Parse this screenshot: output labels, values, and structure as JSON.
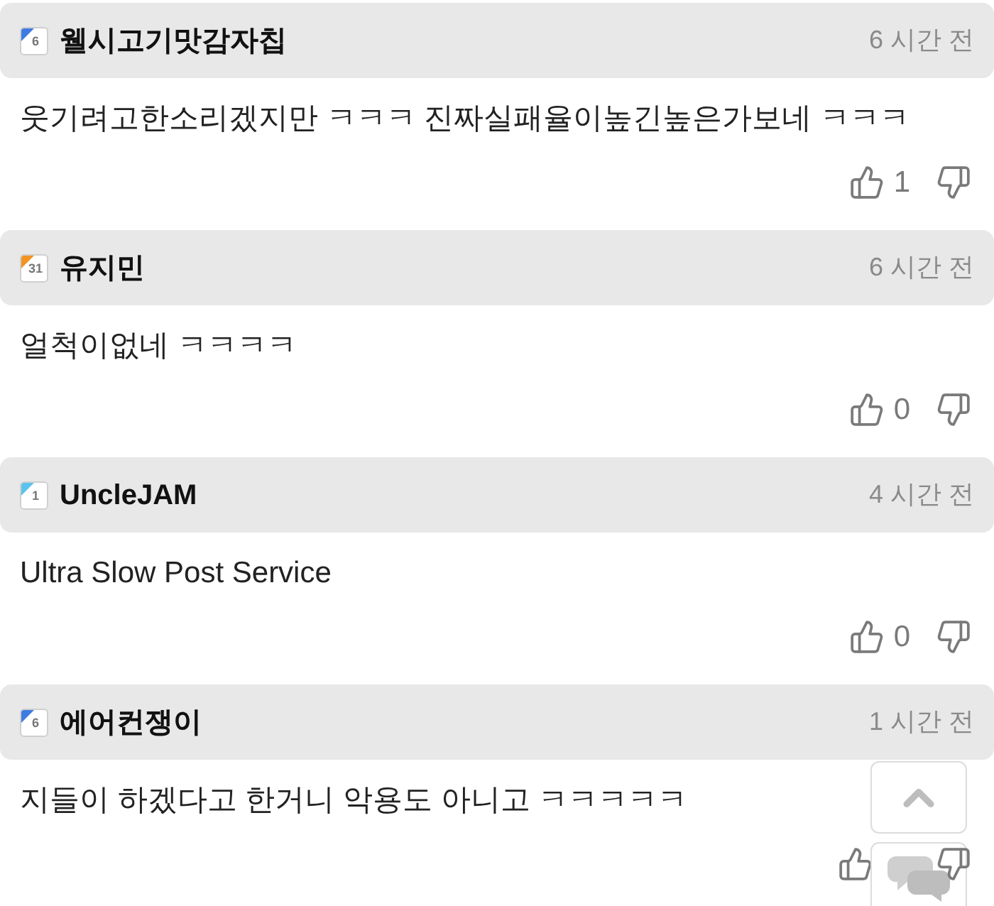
{
  "comments": [
    {
      "author": {
        "name": "웰시고기맛감자칩",
        "badge": {
          "text": "6",
          "color": "#3d7be0"
        }
      },
      "time": "6 시간 전",
      "text": "웃기려고한소리겠지만 ㅋㅋㅋ 진짜실패율이높긴높은가보네 ㅋㅋㅋ",
      "votes": {
        "up": "1"
      }
    },
    {
      "author": {
        "name": "유지민",
        "badge": {
          "text": "31",
          "color": "#f29322"
        }
      },
      "time": "6 시간 전",
      "text": "얼척이없네 ㅋㅋㅋㅋ",
      "votes": {
        "up": "0"
      }
    },
    {
      "author": {
        "name": "UncleJAM",
        "badge": {
          "text": "1",
          "color": "#5cc3ee"
        }
      },
      "time": "4 시간 전",
      "text": "Ultra Slow Post Service",
      "votes": {
        "up": "0"
      }
    },
    {
      "author": {
        "name": "에어컨쟁이",
        "badge": {
          "text": "6",
          "color": "#3d7be0"
        }
      },
      "time": "1 시간 전",
      "text": "지들이 하겠다고 한거니 악용도 아니고 ㅋㅋㅋㅋㅋ"
    }
  ],
  "floating_buttons": [
    {
      "kind": "top"
    },
    {
      "kind": "chat"
    }
  ]
}
